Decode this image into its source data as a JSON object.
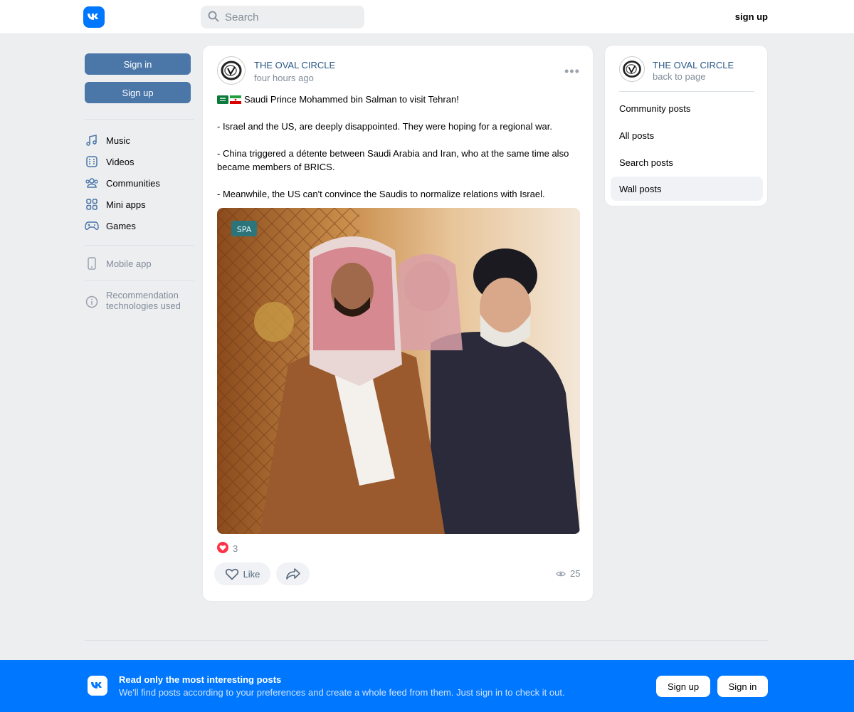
{
  "header": {
    "search_placeholder": "Search",
    "signup_label": "sign up"
  },
  "sidebar": {
    "signin_label": "Sign in",
    "signup_label": "Sign up",
    "items": [
      {
        "label": "Music",
        "icon": "music-icon"
      },
      {
        "label": "Videos",
        "icon": "video-icon"
      },
      {
        "label": "Communities",
        "icon": "communities-icon"
      },
      {
        "label": "Mini apps",
        "icon": "mini-apps-icon"
      },
      {
        "label": "Games",
        "icon": "gamepad-icon"
      }
    ],
    "mobile_app": "Mobile app",
    "recommendation": "Recommendation technologies used"
  },
  "post": {
    "author": "THE OVAL CIRCLE",
    "time": "four hours ago",
    "flags": "🇸🇦🇮🇷",
    "paragraphs": [
      "Saudi Prince Mohammed bin Salman to visit Tehran!",
      "- Israel and the US, are deeply disappointed. They were hoping for a regional war.",
      "- China triggered a détente between Saudi Arabia and Iran, who at the same time also became members of BRICS.",
      "- Meanwhile, the US can't convince the Saudis to normalize relations with Israel."
    ],
    "photo_watermark": "SPA",
    "reaction_count": "3",
    "like_label": "Like",
    "views": "25"
  },
  "community_panel": {
    "name": "THE OVAL CIRCLE",
    "back": "back to page",
    "items": [
      "Community posts",
      "All posts",
      "Search posts",
      "Wall posts"
    ],
    "active_index": 3
  },
  "banner": {
    "title": "Read only the most interesting posts",
    "subtitle": "We'll find posts according to your preferences and create a whole feed from them. Just sign in to check it out.",
    "signup_label": "Sign up",
    "signin_label": "Sign in"
  },
  "colors": {
    "brand": "#0077ff",
    "button_blue": "#4a76a8",
    "link": "#2a5885"
  }
}
